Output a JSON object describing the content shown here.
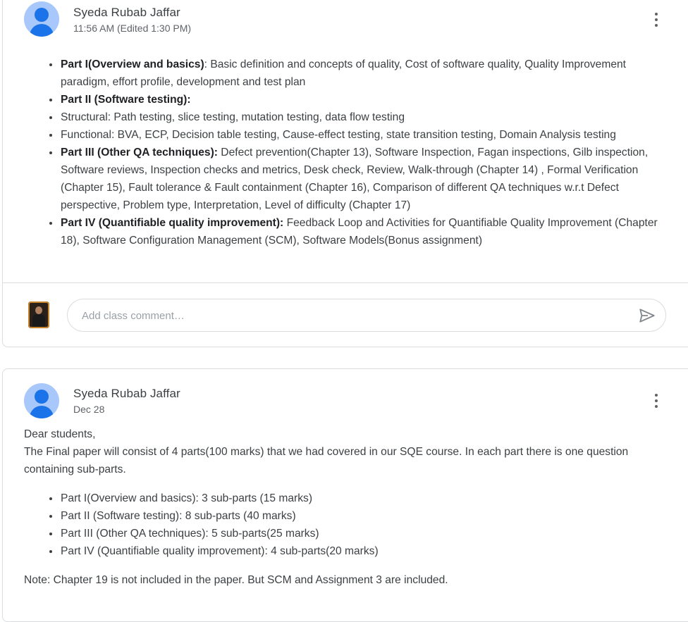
{
  "post1": {
    "author": "Syeda Rubab Jaffar",
    "timestamp": "11:56 AM (Edited 1:30 PM)",
    "items": [
      {
        "bold": "Part I(Overview and basics)",
        "text": ": Basic definition and concepts of quality, Cost of software quality, Quality Improvement paradigm, effort profile, development and test plan"
      },
      {
        "bold": "Part II (Software testing):",
        "text": ""
      },
      {
        "bold": "",
        "text": "Structural: Path testing, slice testing, mutation testing, data flow testing"
      },
      {
        "bold": "",
        "text": "Functional: BVA, ECP, Decision table testing, Cause-effect testing, state transition testing, Domain Analysis testing"
      },
      {
        "bold": "Part III (Other QA techniques):",
        "text": "  Defect prevention(Chapter 13), Software Inspection, Fagan inspections, Gilb inspection, Software reviews, Inspection checks and metrics, Desk check, Review, Walk-through  (Chapter 14) , Formal Verification (Chapter 15), Fault tolerance & Fault containment (Chapter 16), Comparison of different QA techniques w.r.t Defect perspective, Problem type, Interpretation, Level of difficulty (Chapter 17)"
      },
      {
        "bold": "Part IV (Quantifiable quality improvement):",
        "text": " Feedback Loop and Activities for Quantifiable Quality Improvement (Chapter 18), Software Configuration Management (SCM), Software Models(Bonus assignment)"
      }
    ],
    "comment_placeholder": "Add class comment…"
  },
  "post2": {
    "author": "Syeda Rubab Jaffar",
    "timestamp": "Dec 28",
    "greeting": "Dear students,",
    "intro": "The Final paper will consist of 4 parts(100 marks) that we had covered in our SQE course. In each part there is one question containing sub-parts.",
    "items": [
      "Part I(Overview and basics): 3 sub-parts (15 marks)",
      "Part II (Software testing): 8 sub-parts (40 marks)",
      "Part III (Other QA techniques): 5 sub-parts(25 marks)",
      "Part IV (Quantifiable quality improvement): 4 sub-parts(20 marks)"
    ],
    "note": "Note: Chapter 19 is not included in the paper. But SCM and Assignment 3 are included."
  },
  "icons": {
    "avatar": "default-user-avatar-icon",
    "menu": "more-vert-icon",
    "send": "send-icon"
  },
  "colors": {
    "avatar_bg": "#a8c7fa",
    "avatar_fg": "#1a73e8",
    "border": "#dadce0",
    "text": "#3c4043",
    "muted": "#5f6368"
  }
}
